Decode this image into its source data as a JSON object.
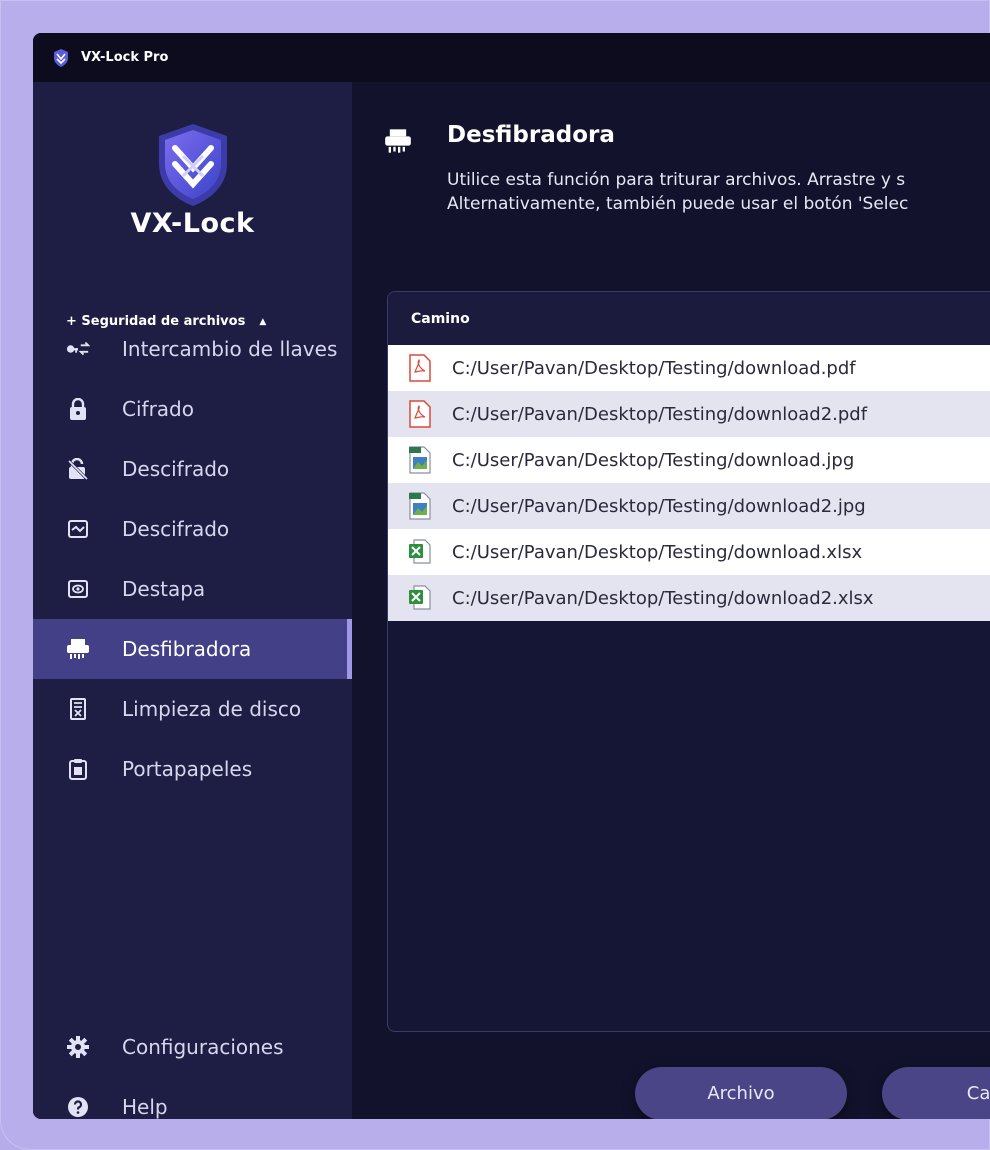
{
  "app": {
    "title": "VX-Lock Pro",
    "logo_text": "VX-Lock"
  },
  "sidebar": {
    "section_label": "+ Seguridad de archivos",
    "section_caret": "▲",
    "items": [
      {
        "label": "Intercambio de llaves",
        "icon": "key-exchange-icon"
      },
      {
        "label": "Cifrado",
        "icon": "lock-icon"
      },
      {
        "label": "Descifrado",
        "icon": "unlock-icon"
      },
      {
        "label": "Descifrado",
        "icon": "image-frame-icon"
      },
      {
        "label": "Destapa",
        "icon": "eye-icon"
      },
      {
        "label": "Desfibradora",
        "icon": "shredder-icon",
        "active": true
      },
      {
        "label": "Limpieza de disco",
        "icon": "disk-clean-icon"
      },
      {
        "label": "Portapapeles",
        "icon": "clipboard-icon"
      }
    ],
    "bottom_items": [
      {
        "label": "Configuraciones",
        "icon": "gear-icon"
      },
      {
        "label": "Help",
        "icon": "help-icon"
      }
    ]
  },
  "main": {
    "title": "Desfibradora",
    "description_line1": "Utilice esta función para triturar archivos. Arrastre y s",
    "description_line2": "Alternativamente, también puede usar el botón 'Selec",
    "table": {
      "header": "Camino",
      "rows": [
        {
          "path": "C:/User/Pavan/Desktop/Testing/download.pdf",
          "type": "pdf"
        },
        {
          "path": "C:/User/Pavan/Desktop/Testing/download2.pdf",
          "type": "pdf"
        },
        {
          "path": "C:/User/Pavan/Desktop/Testing/download.jpg",
          "type": "jpg"
        },
        {
          "path": "C:/User/Pavan/Desktop/Testing/download2.jpg",
          "type": "jpg"
        },
        {
          "path": "C:/User/Pavan/Desktop/Testing/download.xlsx",
          "type": "xlsx"
        },
        {
          "path": "C:/User/Pavan/Desktop/Testing/download2.xlsx",
          "type": "xlsx"
        }
      ]
    },
    "buttons": {
      "file_label": "Archivo",
      "folder_label": "Carp"
    }
  },
  "colors": {
    "outer_bg": "#b8aeeb",
    "sidebar_bg": "#1e1e44",
    "main_bg": "#12122c",
    "active_item": "#434088",
    "button_bg": "#4a4586"
  }
}
